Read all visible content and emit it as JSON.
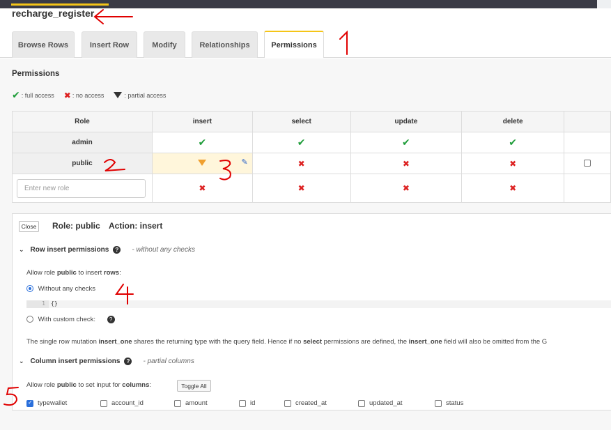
{
  "header": {
    "table_name": "recharge_register"
  },
  "tabs": [
    {
      "label": "Browse Rows"
    },
    {
      "label": "Insert Row"
    },
    {
      "label": "Modify"
    },
    {
      "label": "Relationships"
    },
    {
      "label": "Permissions",
      "active": true
    }
  ],
  "permissions": {
    "title": "Permissions",
    "legend": {
      "full": ": full access",
      "none": ": no access",
      "partial": ": partial access"
    },
    "columns": [
      "Role",
      "insert",
      "select",
      "update",
      "delete"
    ],
    "rows": [
      {
        "role": "admin",
        "insert": "full",
        "select": "full",
        "update": "full",
        "delete": "full"
      },
      {
        "role": "public",
        "insert": "partial",
        "select": "none",
        "update": "none",
        "delete": "none"
      }
    ],
    "new_role_placeholder": "Enter new role",
    "new_role_row": {
      "insert": "none",
      "select": "none",
      "update": "none",
      "delete": "none"
    }
  },
  "editor": {
    "close_label": "Close",
    "role_label": "Role: public",
    "action_label": "Action: insert",
    "row_section": {
      "title": "Row insert permissions",
      "note": "- without any checks"
    },
    "allow_rows": {
      "pre": "Allow role ",
      "role": "public",
      "mid": " to insert ",
      "obj": "rows",
      "post": ":"
    },
    "option_without": "Without any checks",
    "code_line_no": "1",
    "code": "{}",
    "option_custom": "With custom check:",
    "info": {
      "p1": "The single row mutation ",
      "b1": "insert_one",
      "p2": " shares the returning type with the query field. Hence if no ",
      "b2": "select",
      "p3": " permissions are defined, the ",
      "b3": "insert_one",
      "p4": " field will also be omitted from the G"
    },
    "column_section": {
      "title": "Column insert permissions",
      "note": "- partial columns"
    },
    "allow_cols": {
      "pre": "Allow role ",
      "role": "public",
      "mid": " to set input for ",
      "obj": "columns",
      "post": ":"
    },
    "toggle_all": "Toggle All",
    "columns": [
      {
        "name": "typewallet",
        "checked": true
      },
      {
        "name": "account_id",
        "checked": false
      },
      {
        "name": "amount",
        "checked": false
      },
      {
        "name": "id",
        "checked": false
      },
      {
        "name": "created_at",
        "checked": false
      },
      {
        "name": "updated_at",
        "checked": false
      },
      {
        "name": "status",
        "checked": false
      }
    ]
  },
  "colors": {
    "accent": "#f5c518",
    "full": "#1f9d3a",
    "none": "#dd2222",
    "annotation": "#e00000"
  }
}
